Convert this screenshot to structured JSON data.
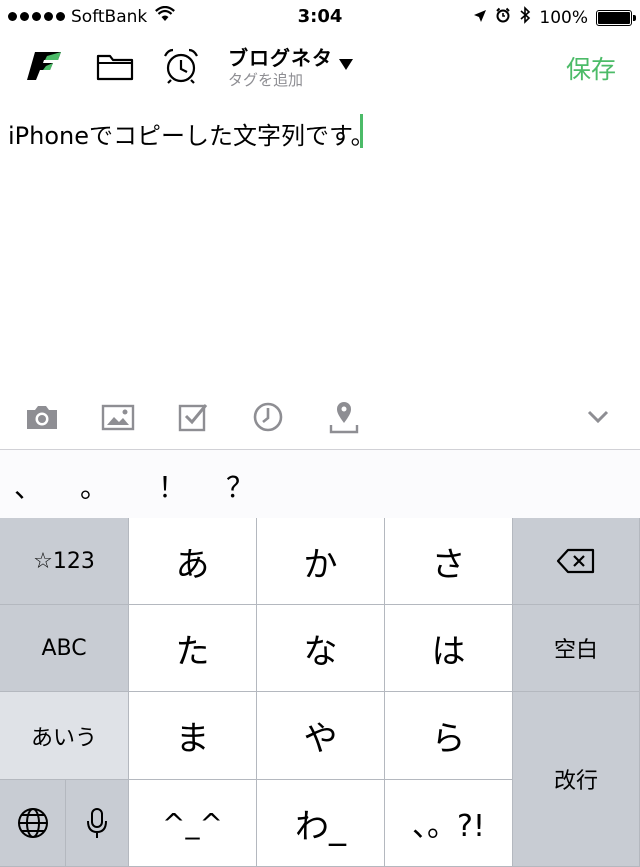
{
  "status_bar": {
    "carrier": "SoftBank",
    "time": "3:04",
    "battery": "100%",
    "battery_level": 1.0
  },
  "nav": {
    "title": "ブログネタ",
    "subtitle": "タグを追加",
    "save_label": "保存"
  },
  "editor": {
    "text": "iPhoneでコピーした文字列です。"
  },
  "toolbar": {
    "icons": [
      "camera-icon",
      "photo-icon",
      "checkbox-icon",
      "reminder-icon",
      "location-icon",
      "chevron-down-icon"
    ]
  },
  "candidates": [
    "、",
    "。",
    "！",
    "？"
  ],
  "keyboard": {
    "symbols": "☆123",
    "abc": "ABC",
    "aiu": "あいう",
    "row1": [
      "あ",
      "か",
      "さ"
    ],
    "row2": [
      "た",
      "な",
      "は"
    ],
    "row3": [
      "ま",
      "や",
      "ら"
    ],
    "row4": [
      "^_^",
      "わ_",
      "、。?!"
    ],
    "space": "空白",
    "return": "改行"
  },
  "colors": {
    "accent": "#4cbb68",
    "keyboard_bg": "#c8ccd3",
    "key_white": "#ffffff"
  }
}
